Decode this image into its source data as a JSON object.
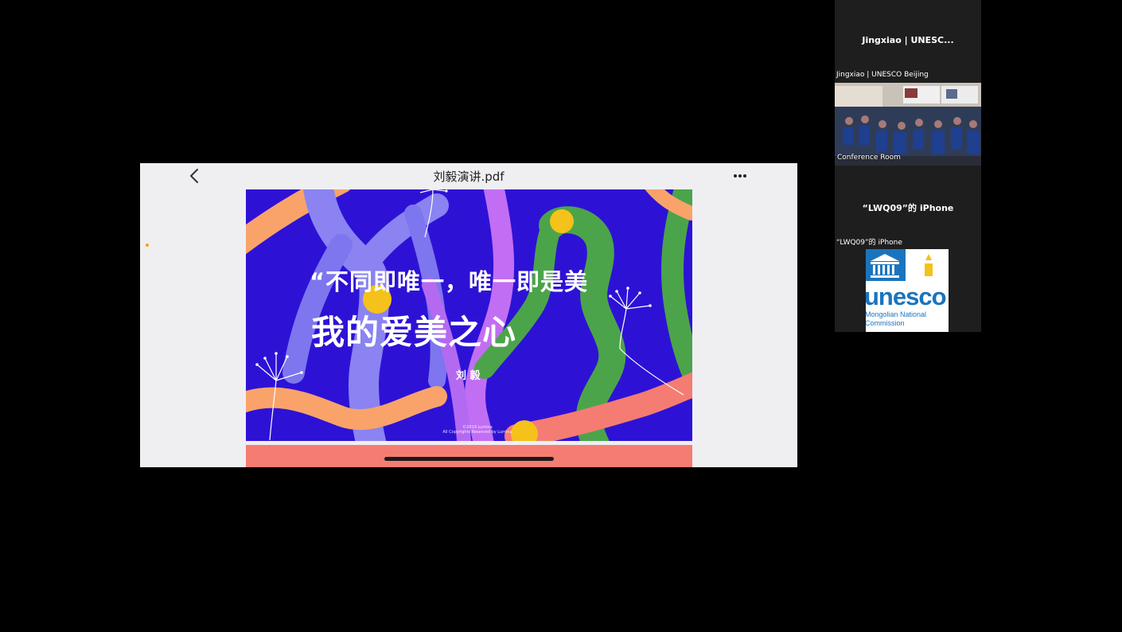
{
  "shared_screen": {
    "document_title": "刘毅演讲.pdf",
    "slide": {
      "quote": "“不同即唯一，唯一即是美",
      "heading": "我的爱美之心",
      "author": "刘 毅",
      "copyright_line1": "©2019 Lumina",
      "copyright_line2": "All Copyrights Reserved by Lumina"
    }
  },
  "participants": [
    {
      "heading": "Jingxiao | UNESC...",
      "name": "Jingxiao | UNESCO Beijing",
      "video_label": "Conference Room"
    },
    {
      "heading": "“LWQ09”的 iPhone",
      "name": "“LWQ09”的 iPhone",
      "logo_word": "unesco",
      "logo_sub_1": "Mongolian National",
      "logo_sub_2": "Commission"
    }
  ],
  "colors": {
    "slide_background": "#2d12d6",
    "next_slide": "#f57c72",
    "panel": "#1e1e1e",
    "unesco_blue": "#1a74bd"
  },
  "icons": {
    "back": "chevron-left-icon",
    "more": "more-horizontal-icon"
  }
}
